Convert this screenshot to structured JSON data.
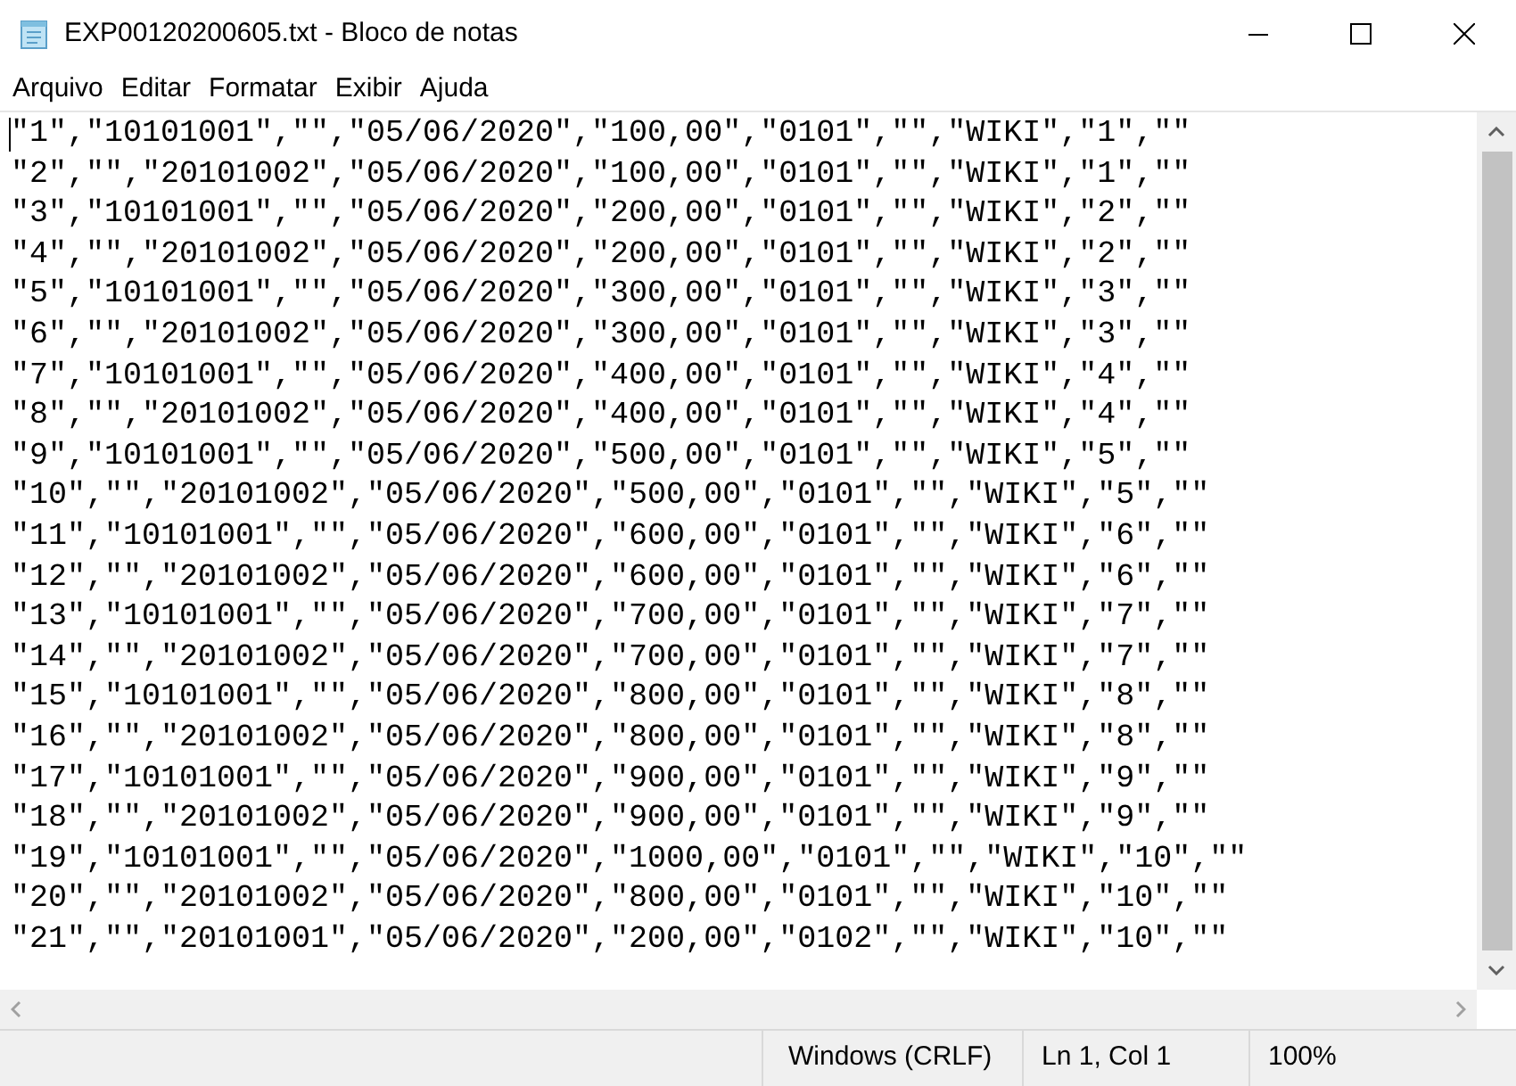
{
  "window": {
    "title": "EXP00120200605.txt - Bloco de notas"
  },
  "menu": [
    "Arquivo",
    "Editar",
    "Formatar",
    "Exibir",
    "Ajuda"
  ],
  "lines": [
    "\"1\",\"10101001\",\"\",\"05/06/2020\",\"100,00\",\"0101\",\"\",\"WIKI\",\"1\",\"\"",
    "\"2\",\"\",\"20101002\",\"05/06/2020\",\"100,00\",\"0101\",\"\",\"WIKI\",\"1\",\"\"",
    "\"3\",\"10101001\",\"\",\"05/06/2020\",\"200,00\",\"0101\",\"\",\"WIKI\",\"2\",\"\"",
    "\"4\",\"\",\"20101002\",\"05/06/2020\",\"200,00\",\"0101\",\"\",\"WIKI\",\"2\",\"\"",
    "\"5\",\"10101001\",\"\",\"05/06/2020\",\"300,00\",\"0101\",\"\",\"WIKI\",\"3\",\"\"",
    "\"6\",\"\",\"20101002\",\"05/06/2020\",\"300,00\",\"0101\",\"\",\"WIKI\",\"3\",\"\"",
    "\"7\",\"10101001\",\"\",\"05/06/2020\",\"400,00\",\"0101\",\"\",\"WIKI\",\"4\",\"\"",
    "\"8\",\"\",\"20101002\",\"05/06/2020\",\"400,00\",\"0101\",\"\",\"WIKI\",\"4\",\"\"",
    "\"9\",\"10101001\",\"\",\"05/06/2020\",\"500,00\",\"0101\",\"\",\"WIKI\",\"5\",\"\"",
    "\"10\",\"\",\"20101002\",\"05/06/2020\",\"500,00\",\"0101\",\"\",\"WIKI\",\"5\",\"\"",
    "\"11\",\"10101001\",\"\",\"05/06/2020\",\"600,00\",\"0101\",\"\",\"WIKI\",\"6\",\"\"",
    "\"12\",\"\",\"20101002\",\"05/06/2020\",\"600,00\",\"0101\",\"\",\"WIKI\",\"6\",\"\"",
    "\"13\",\"10101001\",\"\",\"05/06/2020\",\"700,00\",\"0101\",\"\",\"WIKI\",\"7\",\"\"",
    "\"14\",\"\",\"20101002\",\"05/06/2020\",\"700,00\",\"0101\",\"\",\"WIKI\",\"7\",\"\"",
    "\"15\",\"10101001\",\"\",\"05/06/2020\",\"800,00\",\"0101\",\"\",\"WIKI\",\"8\",\"\"",
    "\"16\",\"\",\"20101002\",\"05/06/2020\",\"800,00\",\"0101\",\"\",\"WIKI\",\"8\",\"\"",
    "\"17\",\"10101001\",\"\",\"05/06/2020\",\"900,00\",\"0101\",\"\",\"WIKI\",\"9\",\"\"",
    "\"18\",\"\",\"20101002\",\"05/06/2020\",\"900,00\",\"0101\",\"\",\"WIKI\",\"9\",\"\"",
    "\"19\",\"10101001\",\"\",\"05/06/2020\",\"1000,00\",\"0101\",\"\",\"WIKI\",\"10\",\"\"",
    "\"20\",\"\",\"20101002\",\"05/06/2020\",\"800,00\",\"0101\",\"\",\"WIKI\",\"10\",\"\"",
    "\"21\",\"\",\"20101001\",\"05/06/2020\",\"200,00\",\"0102\",\"\",\"WIKI\",\"10\",\"\""
  ],
  "status_bar": {
    "line_ending": "Windows (CRLF)",
    "position": "Ln 1, Col 1",
    "zoom": "100%"
  }
}
